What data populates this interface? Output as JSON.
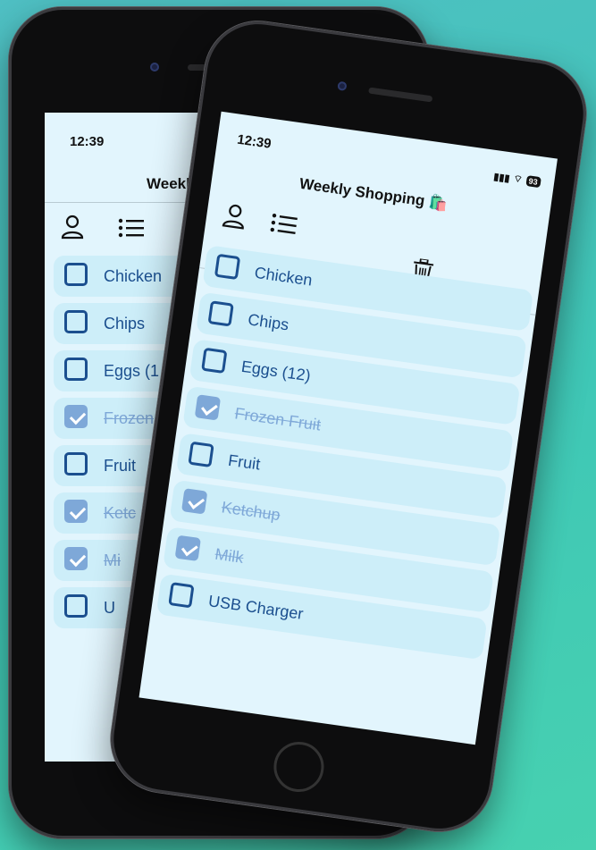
{
  "status_bar": {
    "time": "12:39",
    "battery": "93",
    "signal_icon": "signal-icon",
    "wifi_icon": "wifi-icon"
  },
  "header": {
    "title": "Weekly Shopping",
    "title_emoji": "🛍️",
    "back_title": "Weekly"
  },
  "toolbar": {
    "icons": [
      "person-icon",
      "list-icon",
      "trash-icon",
      "plus-icon"
    ]
  },
  "items": [
    {
      "label": "Chicken",
      "checked": false
    },
    {
      "label": "Chips",
      "checked": false
    },
    {
      "label": "Eggs (12)",
      "checked": false
    },
    {
      "label": "Frozen Fruit",
      "checked": true
    },
    {
      "label": "Fruit",
      "checked": false
    },
    {
      "label": "Ketchup",
      "checked": true
    },
    {
      "label": "Milk",
      "checked": true
    },
    {
      "label": "USB Charger",
      "checked": false
    }
  ],
  "back_phone_items": [
    {
      "label": "Chicken",
      "checked": false
    },
    {
      "label": "Chips",
      "checked": false
    },
    {
      "label": "Eggs (1",
      "checked": false
    },
    {
      "label": "Frozen",
      "checked": true
    },
    {
      "label": "Fruit",
      "checked": false
    },
    {
      "label": "Ketc",
      "checked": true
    },
    {
      "label": "Mi",
      "checked": true
    },
    {
      "label": "U",
      "checked": false
    }
  ],
  "colors": {
    "accent": "#1b4f8f",
    "checked": "#7ea8d8",
    "row_bg": "#cdeef9",
    "screen_bg": "#e2f5fd",
    "background": "#3fc7b6"
  }
}
